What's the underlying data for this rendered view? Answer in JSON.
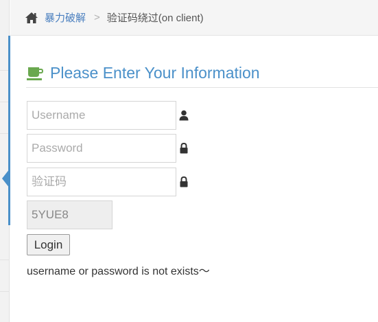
{
  "breadcrumbs": {
    "home_icon": "home-icon",
    "home_label": "暴力破解",
    "separator": ">",
    "current": "验证码绕过(on client)"
  },
  "header": {
    "icon": "coffee-cup-icon",
    "title": "Please Enter Your Information",
    "accent_color": "#4a90c9"
  },
  "form": {
    "username": {
      "placeholder": "Username",
      "value": "",
      "icon": "user-icon"
    },
    "password": {
      "placeholder": "Password",
      "value": "",
      "icon": "lock-icon"
    },
    "vcode": {
      "placeholder": "验证码",
      "value": "",
      "icon": "lock-icon"
    },
    "captcha_text": "5YUE8",
    "login_label": "Login"
  },
  "message": "username or password is not exists～"
}
